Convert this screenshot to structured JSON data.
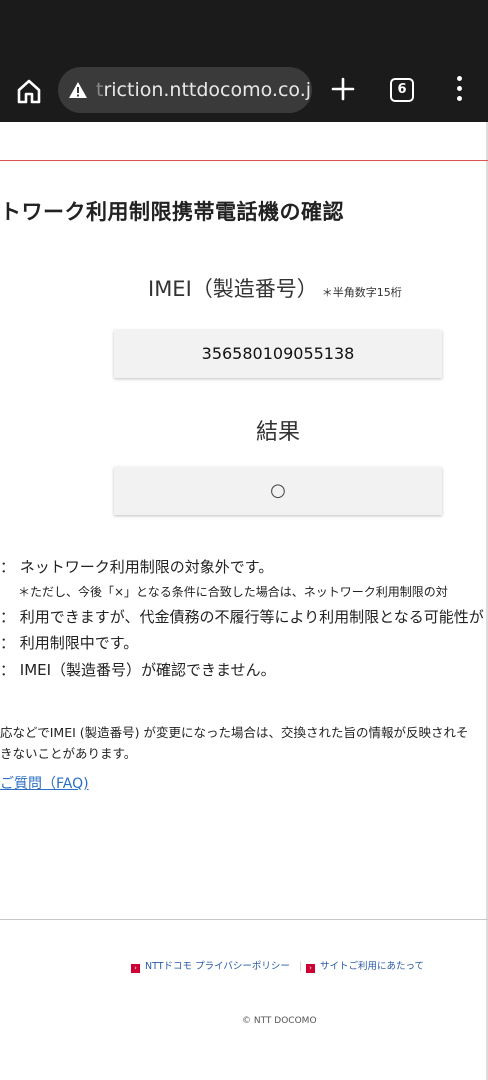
{
  "browser": {
    "url_fade": "t",
    "url": "riction.nttdocomo.co.jp",
    "tab_count": "6",
    "icons": [
      "home-icon",
      "warning-icon",
      "plus-icon",
      "tabs-icon",
      "more-vert-icon"
    ]
  },
  "page": {
    "heading": "トワーク利用制限携帯電話機の確認",
    "imei_label": "IMEI（製造番号）",
    "imei_note": "＊半角数字15桁",
    "imei_value": "356580109055138",
    "result_label": "結果",
    "result_value": "○",
    "legend": [
      "：  ネットワーク利用制限の対象外です。",
      "：  利用できますが、代金債務の不履行等により利用制限となる可能性が",
      "：  利用制限中です。",
      "：  IMEI（製造番号）が確認できません。"
    ],
    "legend_note": "＊ただし、今後「×」となる条件に合致した場合は、ネットワーク利用制限の対",
    "body_line1": "応などでIMEI (製造番号) が変更になった場合は、交換された旨の情報が反映されそ",
    "body_line2": "きないことがあります。",
    "faq_link": "ご質問（FAQ)"
  },
  "footer": {
    "privacy_link": "NTTドコモ プライバシーポリシー",
    "separator": "｜",
    "terms_link": "サイトご利用にあたって",
    "copyright": "© NTT DOCOMO"
  },
  "colors": {
    "toolbar": "#1b1b1b",
    "url_pill": "#3a3a3a",
    "accent_red": "#d9534f",
    "link_blue": "#2a6fc4",
    "footer_arrow": "#cc0033"
  }
}
